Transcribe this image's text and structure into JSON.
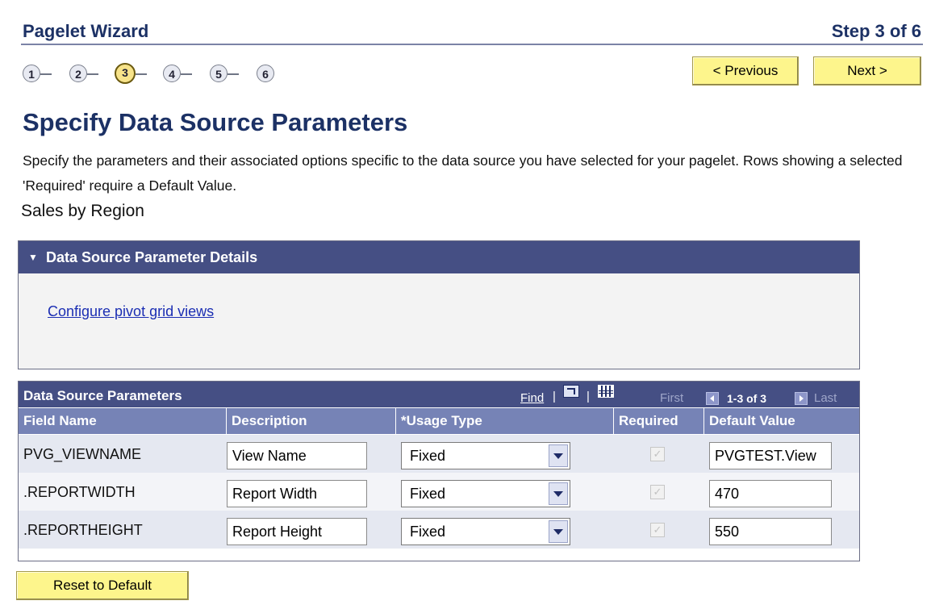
{
  "wizard": {
    "title": "Pagelet Wizard",
    "step_text": "Step 3 of 6",
    "steps": [
      "1",
      "2",
      "3",
      "4",
      "5",
      "6"
    ],
    "active_step": 3
  },
  "nav": {
    "previous_label": "< Previous",
    "next_label": "Next >"
  },
  "page": {
    "heading": "Specify Data Source Parameters",
    "instructions": "Specify the parameters and their associated options specific to the data source you have selected for your pagelet.  Rows showing a selected 'Required' require a Default Value.",
    "data_source_name": "Sales by Region"
  },
  "details_panel": {
    "title": "Data Source Parameter Details",
    "link": "Configure pivot grid views"
  },
  "params_grid": {
    "title": "Data Source Parameters",
    "find_label": "Find",
    "separator": "|",
    "first_label": "First",
    "count": "1-3 of 3",
    "last_label": "Last",
    "columns": [
      "Field Name",
      "Description",
      "*Usage Type",
      "Required",
      "Default Value"
    ],
    "rows": [
      {
        "field_name": "PVG_VIEWNAME",
        "description": "View Name",
        "usage_type": "Fixed",
        "required": true,
        "default_value": "PVGTEST.View"
      },
      {
        "field_name": ".REPORTWIDTH",
        "description": "Report Width",
        "usage_type": "Fixed",
        "required": true,
        "default_value": "470"
      },
      {
        "field_name": ".REPORTHEIGHT",
        "description": "Report Height",
        "usage_type": "Fixed",
        "required": true,
        "default_value": "550"
      }
    ]
  },
  "footer": {
    "reset_label": "Reset to Default"
  },
  "colors": {
    "title": "#1c3165",
    "header_bar": "#454f84",
    "column_header": "#7683b6",
    "button_yellow": "#fdf58c",
    "active_step": "#f7e38a",
    "link": "#1b2eb3"
  },
  "icons": [
    "view-all-icon",
    "download-grid-icon",
    "previous-row-icon",
    "next-row-icon",
    "dropdown-arrow-icon",
    "collapse-arrow-icon"
  ]
}
